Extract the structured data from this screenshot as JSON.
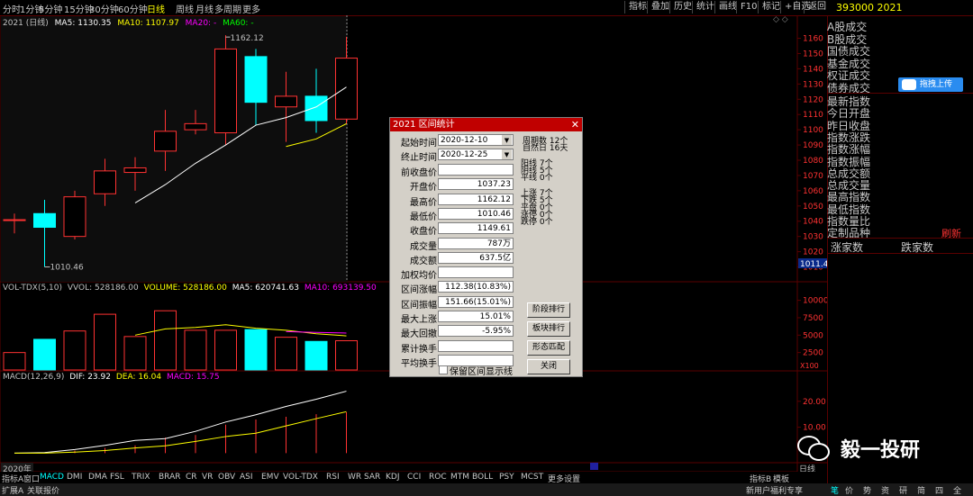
{
  "toolbar": {
    "left": [
      "分时",
      "1分钟",
      "5分钟",
      "15分钟",
      "30分钟",
      "60分钟",
      "日线",
      "周线",
      "月线",
      "多周期",
      "更多"
    ],
    "active": "日线",
    "right": [
      "指标",
      "叠加",
      "历史",
      "统计",
      "画线",
      "F10",
      "标记",
      "+自选",
      "返回"
    ]
  },
  "kline_header": {
    "title": "2021 (日线)",
    "ma5": "MA5: 1130.35",
    "ma10": "MA10: 1107.97",
    "ma20": "MA20: -",
    "ma60": "MA60: -"
  },
  "price_axis": [
    "1160",
    "1150",
    "1140",
    "1130",
    "1120",
    "1110",
    "1100",
    "1090",
    "1080",
    "1070",
    "1060",
    "1050",
    "1040",
    "1030",
    "1020",
    "1010"
  ],
  "price_labels": {
    "high": "1162.12",
    "low": "1010.46",
    "current": "1011.4"
  },
  "chart_data": [
    {
      "type": "candlestick",
      "title": "2021 (日线)",
      "ylim": [
        1005,
        1168
      ],
      "candles": [
        {
          "open": 1041,
          "close": 1041,
          "high": 1045,
          "low": 1032
        },
        {
          "open": 1045,
          "close": 1036,
          "high": 1054,
          "low": 1010
        },
        {
          "open": 1030,
          "close": 1056,
          "high": 1060,
          "low": 1028
        },
        {
          "open": 1058,
          "close": 1073,
          "high": 1081,
          "low": 1050
        },
        {
          "open": 1072,
          "close": 1075,
          "high": 1082,
          "low": 1060
        },
        {
          "open": 1086,
          "close": 1099,
          "high": 1113,
          "low": 1073
        },
        {
          "open": 1100,
          "close": 1104,
          "high": 1113,
          "low": 1097
        },
        {
          "open": 1098,
          "close": 1153,
          "high": 1162,
          "low": 1090
        },
        {
          "open": 1148,
          "close": 1118,
          "high": 1153,
          "low": 1103
        },
        {
          "open": 1115,
          "close": 1122,
          "high": 1138,
          "low": 1092
        },
        {
          "open": 1122,
          "close": 1106,
          "high": 1140,
          "low": 1098
        },
        {
          "open": 1107,
          "close": 1147,
          "high": 1161,
          "low": 1104
        }
      ],
      "ma5": [
        null,
        null,
        null,
        null,
        1052,
        1064,
        1078,
        1090,
        1103,
        1108,
        1115,
        1128
      ],
      "ma10": [
        null,
        null,
        null,
        null,
        null,
        null,
        null,
        null,
        null,
        1089,
        1094,
        1104
      ]
    },
    {
      "type": "bar",
      "title": "VOL-TDX(5,10)",
      "series": [
        {
          "name": "VVOL",
          "values": [
            2500,
            4400,
            5600,
            8000,
            4800,
            8500,
            5700,
            5700,
            5800,
            4700,
            4100,
            4200
          ]
        }
      ],
      "ma5_line": [
        null,
        null,
        null,
        null,
        5000,
        5900,
        6100,
        6500,
        6000,
        5700,
        5200,
        4900
      ],
      "ma10_line": [
        null,
        null,
        null,
        null,
        null,
        null,
        null,
        null,
        null,
        5500,
        5400,
        5300
      ],
      "ylim": [
        0,
        11500
      ]
    },
    {
      "type": "line",
      "title": "MACD(12,26,9)",
      "series": [
        {
          "name": "DIF",
          "values": [
            0,
            0.2,
            1.4,
            3.0,
            4.9,
            5.6,
            8.4,
            12.0,
            14.8,
            18.0,
            20.8,
            23.9
          ]
        },
        {
          "name": "DEA",
          "values": [
            0,
            0,
            0.4,
            1.0,
            2.0,
            2.8,
            4.5,
            6.4,
            7.7,
            10.5,
            13.3,
            16.0
          ]
        }
      ],
      "macd_bars": [
        0,
        0,
        1,
        2,
        3,
        6,
        7,
        11,
        13,
        14,
        15,
        15.75
      ],
      "ylim": [
        -3,
        30
      ]
    }
  ],
  "vol_header": {
    "title": "VOL-TDX(5,10)",
    "vvol": "VVOL: 528186.00",
    "volume": "VOLUME: 528186.00",
    "ma5": "MA5: 620741.63",
    "ma10": "MA10: 693139.50"
  },
  "vol_axis": [
    "10000",
    "7500",
    "5000",
    "2500"
  ],
  "vol_unit": "X100",
  "macd_header": {
    "title": "MACD(12,26,9)",
    "dif": "DIF: 23.92",
    "dea": "DEA: 16.04",
    "macd": "MACD: 15.75"
  },
  "macd_axis": [
    "20.00",
    "10.00"
  ],
  "xaxis_label": "2020年",
  "period_label": "日线",
  "colors": {
    "up": "#ff3232",
    "down": "#00ffff",
    "ma5": "#ffffff",
    "ma10": "#ffff00",
    "ma20": "#ff00ff",
    "frame": "#5a0000"
  },
  "dialog": {
    "title": "2021 区间统计",
    "start_label": "起始时间",
    "start_value": "2020-12-10",
    "end_label": "终止时间",
    "end_value": "2020-12-25",
    "rows": [
      {
        "label": "前收盘价",
        "value": ""
      },
      {
        "label": "开盘价",
        "value": "1037.23"
      },
      {
        "label": "最高价",
        "value": "1162.12"
      },
      {
        "label": "最低价",
        "value": "1010.46"
      },
      {
        "label": "收盘价",
        "value": "1149.61"
      },
      {
        "label": "成交量",
        "value": "787万"
      },
      {
        "label": "成交额",
        "value": "637.5亿"
      },
      {
        "label": "加权均价",
        "value": ""
      },
      {
        "label": "区间涨幅",
        "value": "112.38(10.83%)"
      },
      {
        "label": "区间振幅",
        "value": "151.66(15.01%)"
      },
      {
        "label": "最大上涨",
        "value": "15.01%"
      },
      {
        "label": "最大回撤",
        "value": "-5.95%"
      },
      {
        "label": "累计换手",
        "value": ""
      },
      {
        "label": "平均换手",
        "value": ""
      }
    ],
    "period_count": "周期数 12个",
    "natural_days": "自然日 16天",
    "yang": "阳线 7个",
    "yin": "阴线 5个",
    "flat": "平线 0个",
    "up_days": "上涨 7个",
    "down_days": "下跌 5个",
    "flat_days": "平盘 0个",
    "limit_up": "涨停 0个",
    "limit_down": "跌停 0个",
    "buttons": [
      "阶段排行",
      "板块排行",
      "形态匹配",
      "关闭"
    ],
    "checkbox": "保留区间显示线"
  },
  "right_panel": {
    "header": "393000 2021",
    "group1": [
      "A股成交",
      "B股成交",
      "国债成交",
      "基金成交",
      "权证成交",
      "债券成交"
    ],
    "upload_btn": "拖拽上传",
    "group2": [
      "最新指数",
      "今日开盘",
      "昨日收盘",
      "指数涨跌",
      "指数涨幅",
      "指数振幅",
      "总成交额",
      "总成交量",
      "最高指数",
      "最低指数",
      "指数量比",
      "定制品种"
    ],
    "refresh": "刷新",
    "up_count": "涨家数",
    "down_count": "跌家数"
  },
  "bottom_tabs": [
    "指标A",
    "窗口",
    "MACD",
    "DMI",
    "DMA",
    "FSL",
    "TRIX",
    "BRAR",
    "CR",
    "VR",
    "OBV",
    "ASI",
    "EMV",
    "VOL-TDX",
    "RSI",
    "WR",
    "SAR",
    "KDJ",
    "CCI",
    "ROC",
    "MTM",
    "BOLL",
    "PSY",
    "MCST",
    "更多",
    "设置"
  ],
  "bottom_right": [
    "指标B",
    "模板"
  ],
  "status_left": [
    "扩展A",
    "关联报价"
  ],
  "status_right": [
    "新用户福利专享",
    "笔",
    "价",
    "势",
    "资",
    "研",
    "简",
    "四",
    "全"
  ],
  "watermark": "毅一投研"
}
